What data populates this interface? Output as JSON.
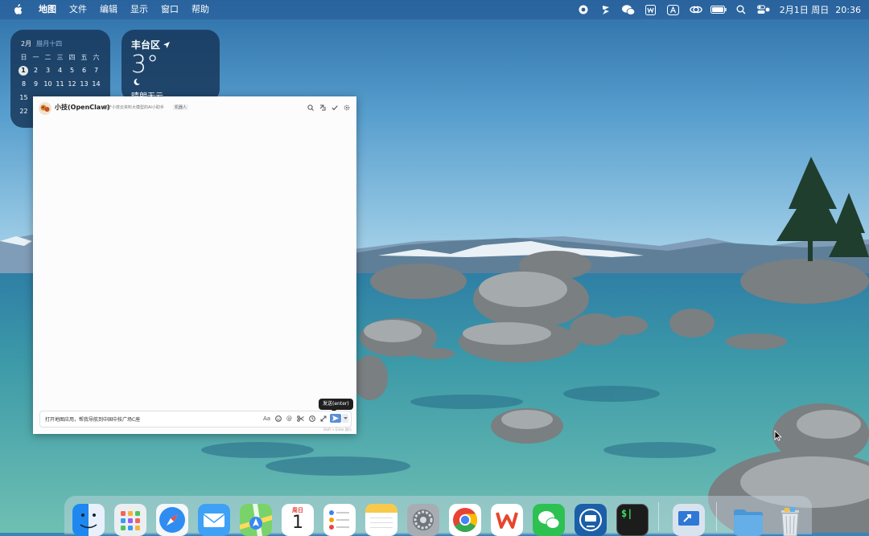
{
  "menubar": {
    "app_name": "地图",
    "items": [
      "文件",
      "编辑",
      "显示",
      "窗口",
      "帮助"
    ],
    "clock_date": "2月1日 周日",
    "clock_time": "20:36",
    "status_icons": [
      "record-icon",
      "stack-icon",
      "wechat-icon",
      "wps-icon",
      "input-method-icon",
      "link-icon",
      "battery-icon",
      "spotlight-icon",
      "control-center-icon"
    ]
  },
  "calendar_widget": {
    "month": "2月",
    "lunar": "腊月十四",
    "weekdays": [
      "日",
      "一",
      "二",
      "三",
      "四",
      "五",
      "六"
    ],
    "rows": [
      [
        "1",
        "2",
        "3",
        "4",
        "5",
        "6",
        "7"
      ],
      [
        "8",
        "9",
        "10",
        "11",
        "12",
        "13",
        "14"
      ],
      [
        "15",
        "",
        "",
        "",
        "",
        "",
        ""
      ],
      [
        "22",
        "",
        "",
        "",
        "",
        "",
        ""
      ]
    ],
    "today": "1"
  },
  "weather_widget": {
    "location": "丰台区",
    "temperature": "3°",
    "condition": "晴朗无云"
  },
  "chat": {
    "bot_name": "小技(OpenClaw)",
    "bot_description": "基于小技云资料大模型的AI小助手",
    "bot_tag": "机器人",
    "header_icons": [
      "search-icon",
      "pin-icon",
      "check-icon",
      "settings-icon"
    ],
    "input_value": "打开地图应用，帮我导航到中国中技广场C座",
    "tooltip": "发送(enter)",
    "composer_tools": [
      "format-icon",
      "emoji-icon",
      "mention-icon",
      "scissors-icon",
      "history-icon",
      "expand-icon"
    ],
    "hint": "Shift + Enter 换行"
  },
  "dock": {
    "apps": [
      "Finder",
      "Launchpad",
      "Safari",
      "Mail",
      "Maps",
      "Calendar",
      "Reminders",
      "Notes",
      "System Settings",
      "Chrome",
      "WPS Office",
      "WeChat",
      "Apple Configurator",
      "Terminal",
      "Screen Sharing",
      "Downloads",
      "Trash"
    ],
    "calendar_month": "周日",
    "calendar_day": "1",
    "terminal_glyph": "$|"
  },
  "colors": {
    "accent": "#5a8fd8",
    "menubar": "#2d5a8a",
    "widget_bg": "#14325a",
    "chat_bg": "#fcfcfc"
  }
}
